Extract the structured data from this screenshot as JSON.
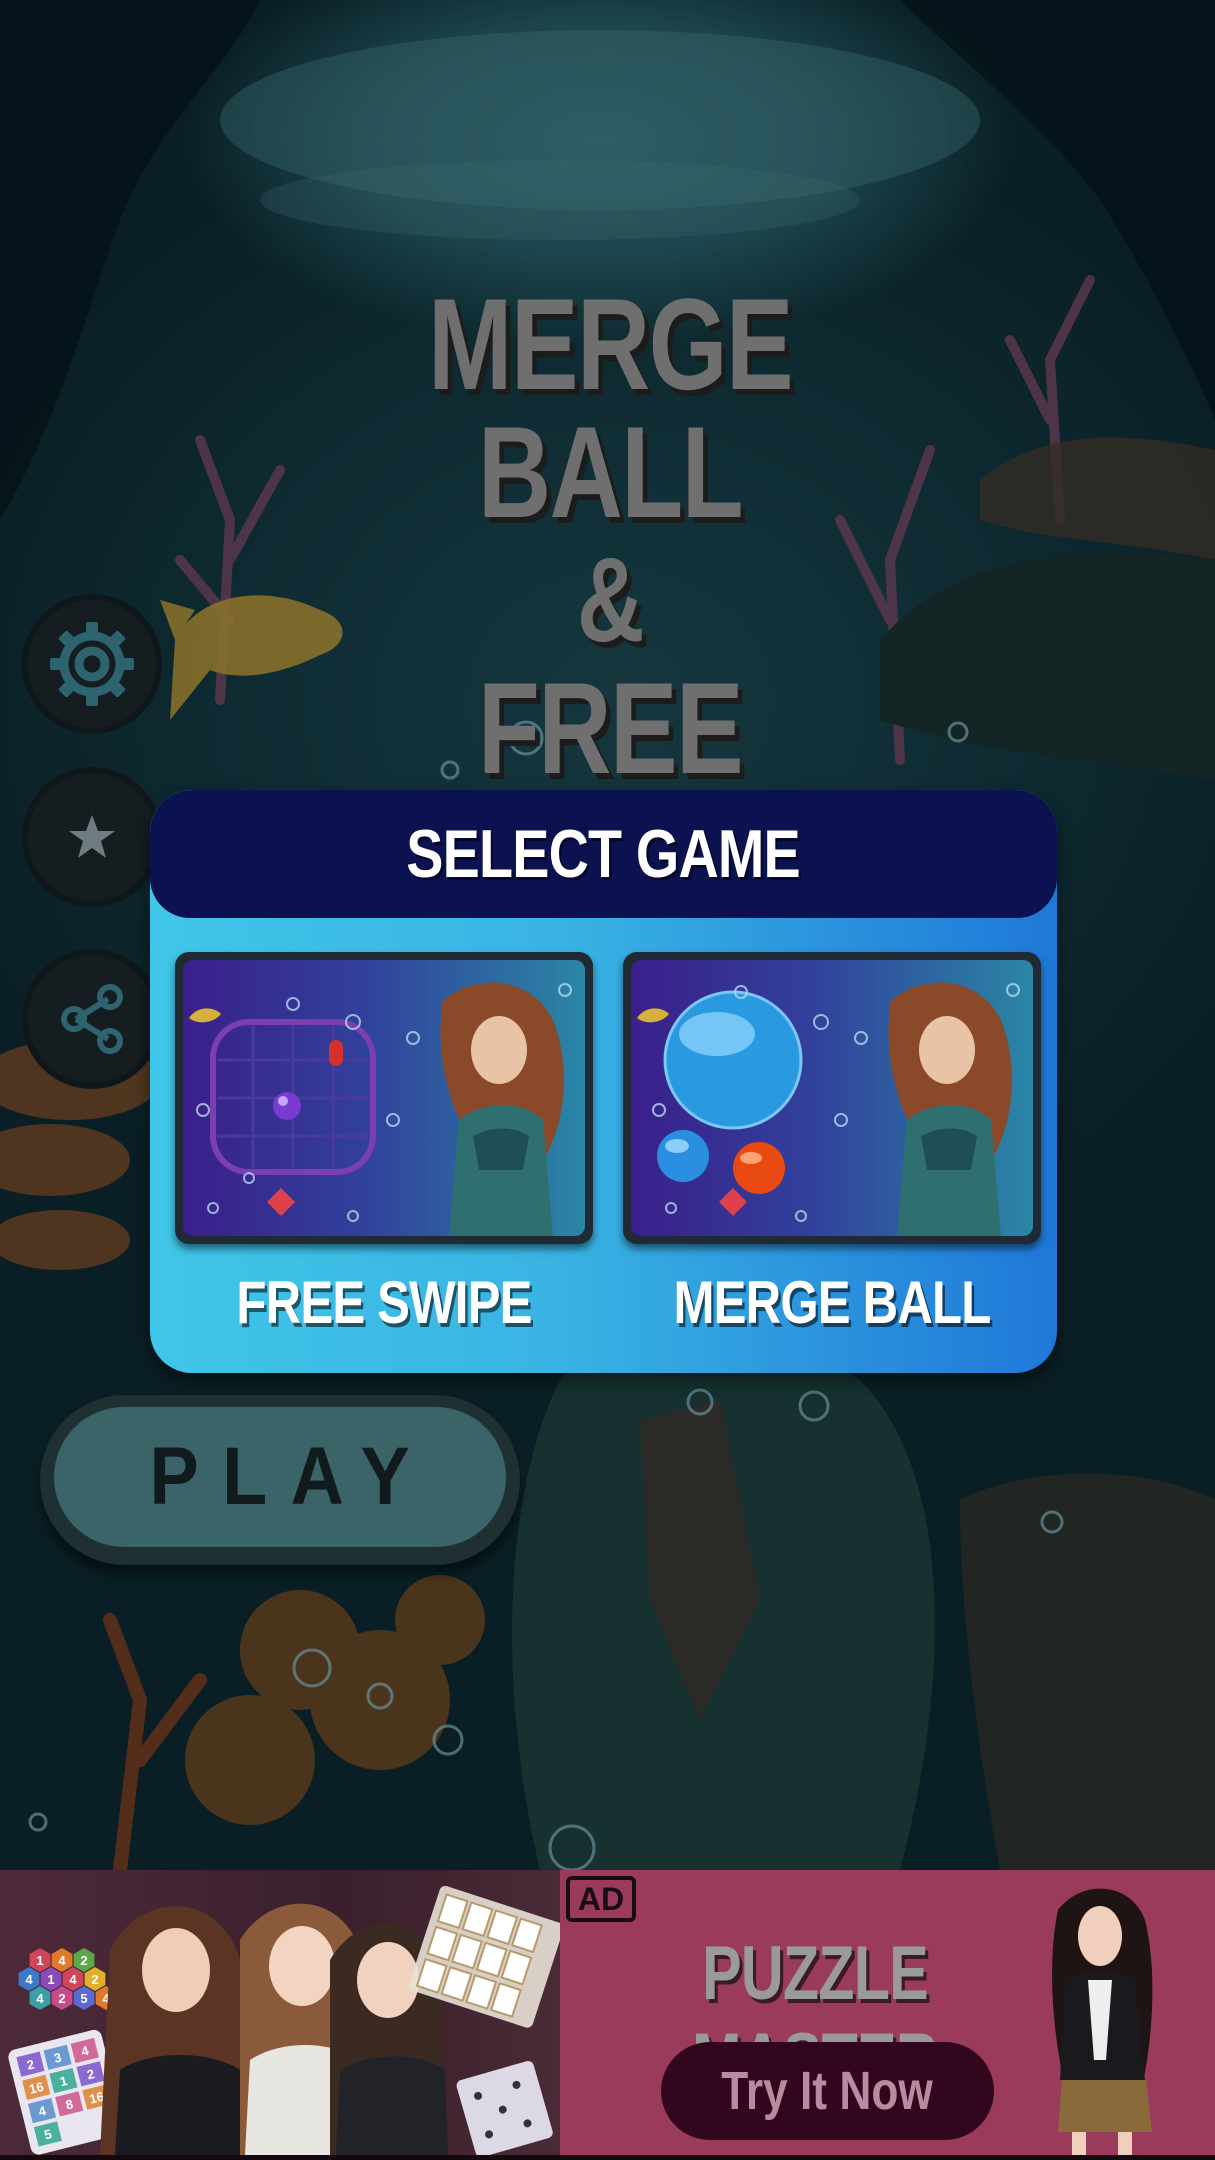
{
  "title": {
    "line1": "MERGE BALL",
    "amp": "&",
    "line2": "FREE SWIPE"
  },
  "side_buttons": {
    "settings": "settings-gear-icon",
    "rate": "star-icon",
    "share": "share-icon"
  },
  "dialog": {
    "title": "SELECT GAME",
    "games": [
      {
        "label": "FREE SWIPE",
        "thumbnail": "free-swipe-thumbnail"
      },
      {
        "label": "MERGE BALL",
        "thumbnail": "merge-ball-thumbnail"
      }
    ]
  },
  "play": {
    "label": "PLAY"
  },
  "ad": {
    "badge": "AD",
    "title": "PUZZLE MASTER",
    "cta": "Try It Now",
    "hex_numbers": [
      "1",
      "4",
      "2",
      "4",
      "1",
      "4",
      "2",
      "4",
      "2",
      "5",
      "4"
    ],
    "grid_numbers": [
      "2",
      "3",
      "4",
      "16",
      "1",
      "2",
      "4",
      "8",
      "16",
      "5"
    ]
  },
  "colors": {
    "dialog_header": "#0c1250",
    "dialog_body_start": "#40c6e8",
    "dialog_body_end": "#1f78d8",
    "play_fill": "#3a6468",
    "ad_right_bg": "#9b3b5c",
    "ad_cta_bg": "#32071e"
  }
}
